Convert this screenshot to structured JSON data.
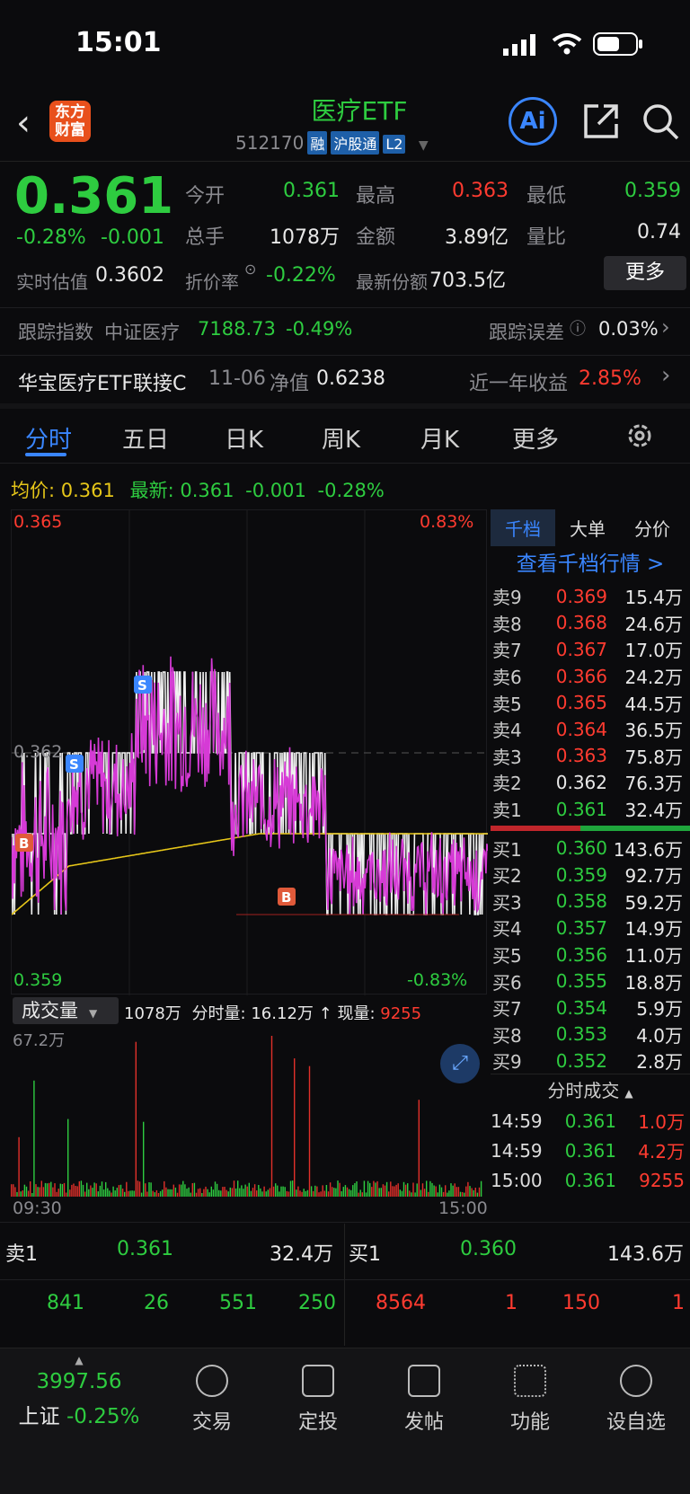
{
  "status": {
    "time": "15:01"
  },
  "header": {
    "logo_text": "东方财富",
    "title": "医疗ETF",
    "code": "512170",
    "tags": [
      "融",
      "沪股通",
      "L2"
    ],
    "ai_label": "Ai"
  },
  "quote": {
    "price": "0.361",
    "pct": "-0.28%",
    "chg": "-0.001",
    "open_label": "今开",
    "open": "0.361",
    "high_label": "最高",
    "high": "0.363",
    "low_label": "最低",
    "low": "0.359",
    "vol_label": "总手",
    "vol": "1078万",
    "amt_label": "金额",
    "amt": "3.89亿",
    "ratio_label": "量比",
    "ratio": "0.74",
    "est_label": "实时估值",
    "est": "0.3602",
    "disc_label": "折价率",
    "disc": "-0.22%",
    "share_label": "最新份额",
    "share": "703.5亿",
    "more": "更多"
  },
  "track": {
    "label": "跟踪指数",
    "index": "中证医疗",
    "value": "7188.73",
    "pct": "-0.49%",
    "err_label": "跟踪误差",
    "err": "0.03%"
  },
  "linked": {
    "name": "华宝医疗ETF联接C",
    "date": "11-06",
    "nav_label": "净值",
    "nav": "0.6238",
    "yr_label": "近一年收益",
    "yr": "2.85%"
  },
  "tabs": [
    "分时",
    "五日",
    "日K",
    "周K",
    "月K",
    "更多"
  ],
  "avgline": {
    "avg_label": "均价:",
    "avg": "0.361",
    "last_label": "最新:",
    "last": "0.361",
    "chg": "-0.001",
    "pct": "-0.28%"
  },
  "chart_data": {
    "type": "line",
    "y_top": "0.365",
    "y_mid": "0.362",
    "y_bot": "0.359",
    "pct_top": "0.83%",
    "pct_bot": "-0.83%",
    "x_start": "09:30",
    "x_end": "15:00",
    "vol_label": "成交量",
    "vol_total": "1078万",
    "vol_min_label": "分时量:",
    "vol_min": "16.12万",
    "vol_now_label": "现量:",
    "vol_now": "9255",
    "vol_max": "67.2万"
  },
  "book": {
    "tabs": [
      "千档",
      "大单",
      "分价"
    ],
    "link": "查看千档行情 >",
    "asks": [
      {
        "l": "卖9",
        "p": "0.369",
        "v": "15.4万",
        "c": "r"
      },
      {
        "l": "卖8",
        "p": "0.368",
        "v": "24.6万",
        "c": "r"
      },
      {
        "l": "卖7",
        "p": "0.367",
        "v": "17.0万",
        "c": "r"
      },
      {
        "l": "卖6",
        "p": "0.366",
        "v": "24.2万",
        "c": "r"
      },
      {
        "l": "卖5",
        "p": "0.365",
        "v": "44.5万",
        "c": "r"
      },
      {
        "l": "卖4",
        "p": "0.364",
        "v": "36.5万",
        "c": "r"
      },
      {
        "l": "卖3",
        "p": "0.363",
        "v": "75.8万",
        "c": "r"
      },
      {
        "l": "卖2",
        "p": "0.362",
        "v": "76.3万",
        "c": "w"
      },
      {
        "l": "卖1",
        "p": "0.361",
        "v": "32.4万",
        "c": "g"
      }
    ],
    "bids": [
      {
        "l": "买1",
        "p": "0.360",
        "v": "143.6万",
        "c": "g"
      },
      {
        "l": "买2",
        "p": "0.359",
        "v": "92.7万",
        "c": "g"
      },
      {
        "l": "买3",
        "p": "0.358",
        "v": "59.2万",
        "c": "g"
      },
      {
        "l": "买4",
        "p": "0.357",
        "v": "14.9万",
        "c": "g"
      },
      {
        "l": "买5",
        "p": "0.356",
        "v": "11.0万",
        "c": "g"
      },
      {
        "l": "买6",
        "p": "0.355",
        "v": "18.8万",
        "c": "g"
      },
      {
        "l": "买7",
        "p": "0.354",
        "v": "5.9万",
        "c": "g"
      },
      {
        "l": "买8",
        "p": "0.353",
        "v": "4.0万",
        "c": "g"
      },
      {
        "l": "买9",
        "p": "0.352",
        "v": "2.8万",
        "c": "g"
      }
    ],
    "ticks_label": "分时成交",
    "ticks": [
      {
        "t": "14:59",
        "p": "0.361",
        "v": "1.0万"
      },
      {
        "t": "14:59",
        "p": "0.361",
        "v": "4.2万"
      },
      {
        "t": "15:00",
        "p": "0.361",
        "v": "9255"
      }
    ]
  },
  "bottomquote": {
    "sell_label": "卖1",
    "sell_p": "0.361",
    "sell_v": "32.4万",
    "buy_label": "买1",
    "buy_p": "0.360",
    "buy_v": "143.6万",
    "row": [
      "841",
      "26",
      "551",
      "250",
      "8564",
      "1",
      "150",
      "1"
    ]
  },
  "nav": {
    "index_val": "3997.56",
    "index_name": "上证",
    "index_pct": "-0.25%",
    "items": [
      "交易",
      "定投",
      "发帖",
      "功能",
      "设自选"
    ]
  }
}
